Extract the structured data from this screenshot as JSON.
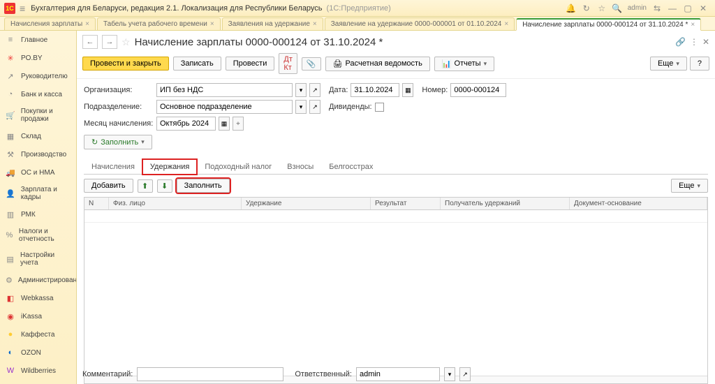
{
  "titlebar": {
    "app_title": "Бухгалтерия для Беларуси, редакция 2.1. Локализация для Республики Беларусь",
    "app_subtitle": "(1С:Предприятие)",
    "user": "admin"
  },
  "tabs": [
    {
      "label": "Начисления зарплаты",
      "active": false
    },
    {
      "label": "Табель учета рабочего времени",
      "active": false
    },
    {
      "label": "Заявления на удержание",
      "active": false
    },
    {
      "label": "Заявление на удержание 0000-000001 от 01.10.2024",
      "active": false
    },
    {
      "label": "Начисление зарплаты 0000-000124 от 31.10.2024 *",
      "active": true
    }
  ],
  "sidebar": [
    {
      "icon": "≡",
      "label": "Главное"
    },
    {
      "icon": "✳",
      "label": "PO.BY",
      "color": "#e33"
    },
    {
      "icon": "↗",
      "label": "Руководителю"
    },
    {
      "icon": "◔",
      "label": "Банк и касса"
    },
    {
      "icon": "🛒",
      "label": "Покупки и продажи"
    },
    {
      "icon": "▦",
      "label": "Склад"
    },
    {
      "icon": "⚒",
      "label": "Производство"
    },
    {
      "icon": "🚚",
      "label": "ОС и НМА"
    },
    {
      "icon": "👤",
      "label": "Зарплата и кадры"
    },
    {
      "icon": "▥",
      "label": "РМК"
    },
    {
      "icon": "%",
      "label": "Налоги и отчетность"
    },
    {
      "icon": "▤",
      "label": "Настройки учета"
    },
    {
      "icon": "⚙",
      "label": "Администрирование"
    },
    {
      "icon": "◧",
      "label": "Webkassa",
      "color": "#d33"
    },
    {
      "icon": "◉",
      "label": "iKassa",
      "color": "#d33"
    },
    {
      "icon": "●",
      "label": "Каффеста",
      "color": "#fc3"
    },
    {
      "icon": "◐",
      "label": "OZON",
      "color": "#06c"
    },
    {
      "icon": "W",
      "label": "Wildberries",
      "color": "#93c"
    }
  ],
  "doc": {
    "title": "Начисление зарплаты 0000-000124 от 31.10.2024 *",
    "number": "0000-000124",
    "date": "31.10.2024",
    "organization": "ИП без НДС",
    "department": "Основное подразделение",
    "month": "Октябрь 2024",
    "responsible": "admin",
    "comment": ""
  },
  "labels": {
    "organization": "Организация:",
    "date": "Дата:",
    "number": "Номер:",
    "department": "Подразделение:",
    "dividends": "Дивиденды:",
    "month": "Месяц начисления:",
    "comment": "Комментарий:",
    "responsible": "Ответственный:"
  },
  "buttons": {
    "post_close": "Провести и закрыть",
    "save": "Записать",
    "post": "Провести",
    "print": "Расчетная ведомость",
    "reports": "Отчеты",
    "more": "Еще",
    "help": "?",
    "fill": "Заполнить",
    "add": "Добавить"
  },
  "subtabs": [
    {
      "label": "Начисления",
      "active": false
    },
    {
      "label": "Удержания",
      "active": true,
      "highlighted": true
    },
    {
      "label": "Подоходный налог",
      "active": false
    },
    {
      "label": "Взносы",
      "active": false
    },
    {
      "label": "Белгосстрах",
      "active": false
    }
  ],
  "grid_columns": {
    "n": "N",
    "person": "Физ. лицо",
    "deduction": "Удержание",
    "result": "Результат",
    "recipient": "Получатель удержаний",
    "basis": "Документ-основание"
  }
}
